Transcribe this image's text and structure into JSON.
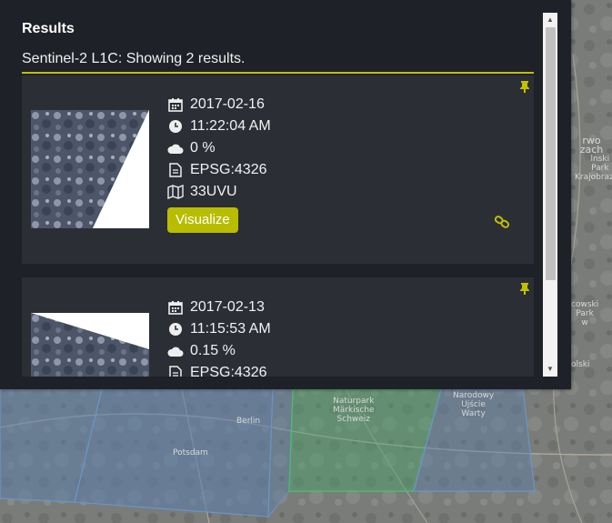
{
  "map": {
    "labels": [
      "Berlin",
      "Potsdam",
      "Naturpark\nMärkische\nSchweiz",
      "Narodowy\nUjście\nWarty",
      "rwo zach",
      "lnski\nPark\nKrajobrazow",
      "cowski\nPark\nw",
      "olski"
    ]
  },
  "panel": {
    "title": "Results",
    "summary": "Sentinel-2 L1C: Showing 2 results."
  },
  "results": [
    {
      "date": "2017-02-16",
      "time": "11:22:04 AM",
      "cloud": "0 %",
      "crs": "EPSG:4326",
      "tile": "33UVU",
      "button_label": "Visualize"
    },
    {
      "date": "2017-02-13",
      "time": "11:15:53 AM",
      "cloud": "0.15 %",
      "crs": "EPSG:4326"
    }
  ],
  "icons": {
    "date": "calendar-icon",
    "time": "clock-icon",
    "cloud": "cloud-icon",
    "crs": "document-icon",
    "tile": "map-icon",
    "pin": "pin-icon",
    "link": "link-icon"
  },
  "colors": {
    "accent": "#b8bd00",
    "panel_bg": "#1f2128",
    "card_bg": "#2c2e36",
    "footprint_blue": "#5b7fa8",
    "footprint_green": "#4aa36a"
  }
}
